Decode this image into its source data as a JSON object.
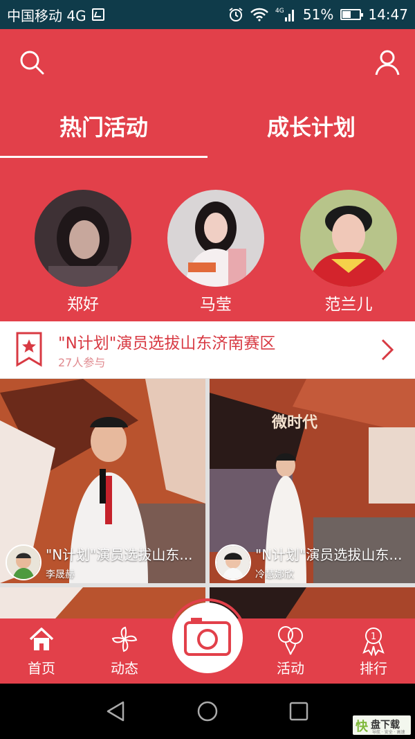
{
  "status_bar": {
    "carrier": "中国移动 4G",
    "network": "4G",
    "battery": "51%",
    "time": "14:47"
  },
  "header": {
    "tabs": [
      {
        "label": "热门活动",
        "active": true
      },
      {
        "label": "成长计划",
        "active": false
      }
    ],
    "stars": [
      {
        "name": "郑好"
      },
      {
        "name": "马莹"
      },
      {
        "name": "范兰儿"
      }
    ]
  },
  "event": {
    "title": "\"N计划\"演员选拔山东济南赛区",
    "participants": "27人参与"
  },
  "cards": [
    {
      "title": "\"N计划\"演员选拔山东...",
      "author": "李晟赫"
    },
    {
      "title": "\"N计划\"演员选拔山东...",
      "author": "冷慧娜欣"
    }
  ],
  "nav": {
    "items": [
      {
        "label": "首页",
        "icon": "home-icon"
      },
      {
        "label": "动态",
        "icon": "pinwheel-icon"
      },
      {
        "label": "活动",
        "icon": "balloons-icon"
      },
      {
        "label": "排行",
        "icon": "ranking-medal-icon"
      }
    ]
  },
  "colors": {
    "brand_red": "#e2404a",
    "statusbar": "#0f3b4a"
  }
}
